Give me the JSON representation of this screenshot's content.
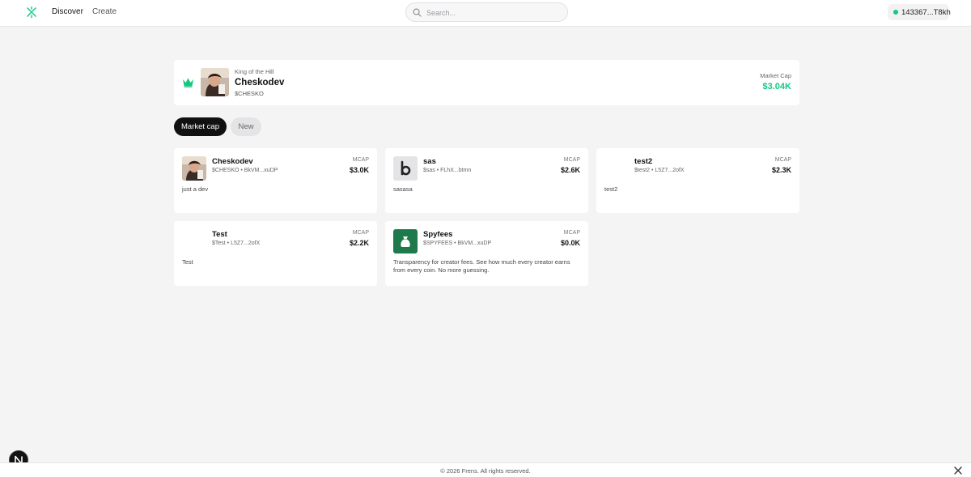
{
  "nav": {
    "discover": "Discover",
    "create": "Create"
  },
  "search": {
    "placeholder": "Search..."
  },
  "wallet": {
    "address": "143367...T8kh",
    "status_color": "#16c784"
  },
  "king_of_hill": {
    "label": "King of the Hill",
    "name": "Cheskodev",
    "ticker": "$CHESKO",
    "market_cap_label": "Market Cap",
    "market_cap": "$3.04K",
    "icon": "crown-icon",
    "accent": "#16c784"
  },
  "filters": {
    "market_cap": "Market cap",
    "new": "New"
  },
  "cards": [
    {
      "name": "Cheskodev",
      "sub": "$CHESKO • BkVM...xuDP",
      "mcap_label": "MCAP",
      "mcap": "$3.0K",
      "description": "just a dev",
      "avatar": "photo"
    },
    {
      "name": "sas",
      "sub": "$sas • FLhX...btmn",
      "mcap_label": "MCAP",
      "mcap": "$2.6K",
      "description": "sasasa",
      "avatar": "b-letter"
    },
    {
      "name": "test2",
      "sub": "$test2 • L5Z7...2ofX",
      "mcap_label": "MCAP",
      "mcap": "$2.3K",
      "description": "test2",
      "avatar": "none"
    },
    {
      "name": "Test",
      "sub": "$Test • L5Z7...2ofX",
      "mcap_label": "MCAP",
      "mcap": "$2.2K",
      "description": "Test",
      "avatar": "none"
    },
    {
      "name": "Spyfees",
      "sub": "$SPYFEES • BkVM...xuDP",
      "mcap_label": "MCAP",
      "mcap": "$0.0K",
      "description": "Transparency for creator fees. See how much every creator earns from every coin. No more guessing.",
      "avatar": "money-bag"
    }
  ],
  "footer": {
    "copyright": "© 2026 Frens. All rights reserved."
  }
}
